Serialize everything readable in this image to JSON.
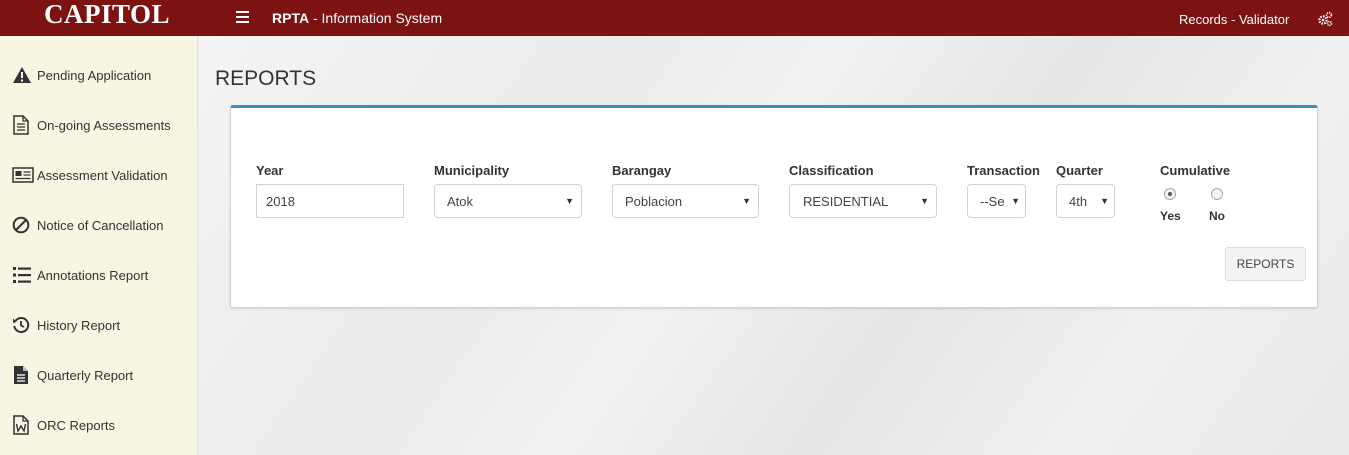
{
  "header": {
    "logo_text": "CAPITOL",
    "app_title_bold": "RPTA",
    "app_title_rest": " - Information System",
    "user_role": "Records - Validator",
    "menu_icon": "hamburger-icon",
    "settings_icon": "gears-icon"
  },
  "colors": {
    "header_bg": "#7d1212",
    "sidebar_bg": "#f6f6e3",
    "card_accent": "#3c8dbc"
  },
  "sidebar": {
    "items": [
      {
        "label": "Pending Application",
        "icon": "warning-icon"
      },
      {
        "label": "On-going Assessments",
        "icon": "document-icon"
      },
      {
        "label": "Assessment Validation",
        "icon": "newspaper-icon"
      },
      {
        "label": "Notice of Cancellation",
        "icon": "ban-icon"
      },
      {
        "label": "Annotations Report",
        "icon": "ordered-list-icon"
      },
      {
        "label": "History Report",
        "icon": "history-icon"
      },
      {
        "label": "Quarterly Report",
        "icon": "file-text-icon"
      },
      {
        "label": "ORC Reports",
        "icon": "word-file-icon"
      }
    ]
  },
  "main": {
    "page_title": "REPORTS",
    "form": {
      "year": {
        "label": "Year",
        "value": "2018"
      },
      "municipality": {
        "label": "Municipality",
        "value": "Atok"
      },
      "barangay": {
        "label": "Barangay",
        "value": "Poblacion"
      },
      "classification": {
        "label": "Classification",
        "value": "RESIDENTIAL"
      },
      "transaction": {
        "label": "Transaction",
        "value": "--Se"
      },
      "quarter": {
        "label": "Quarter",
        "value": "4th"
      },
      "cumulative": {
        "label": "Cumulative",
        "options": [
          {
            "label": "Yes",
            "checked": true
          },
          {
            "label": "No",
            "checked": false
          }
        ]
      }
    },
    "reports_button": "REPORTS"
  }
}
